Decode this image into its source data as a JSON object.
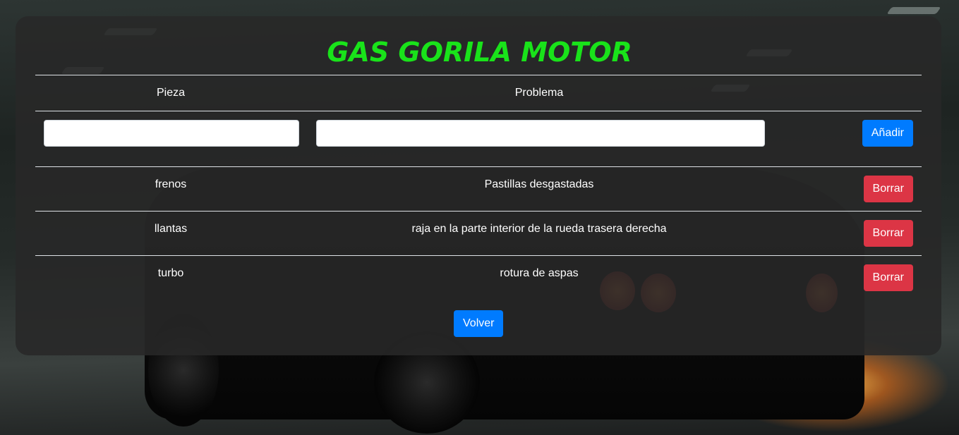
{
  "header": {
    "title": "GAS GORILA MOTOR"
  },
  "table": {
    "columns": [
      "Pieza",
      "Problema"
    ],
    "form": {
      "pieza_value": "",
      "problema_value": "",
      "add_label": "Añadir"
    },
    "rows": [
      {
        "pieza": "frenos",
        "problema": "Pastillas desgastadas",
        "delete_label": "Borrar"
      },
      {
        "pieza": "llantas",
        "problema": "raja en la parte interior de la rueda trasera derecha",
        "delete_label": "Borrar"
      },
      {
        "pieza": "turbo",
        "problema": "rotura de aspas",
        "delete_label": "Borrar"
      }
    ]
  },
  "footer": {
    "back_label": "Volver"
  },
  "colors": {
    "title": "#19e31a",
    "primary": "#007bff",
    "danger": "#dc3545"
  }
}
